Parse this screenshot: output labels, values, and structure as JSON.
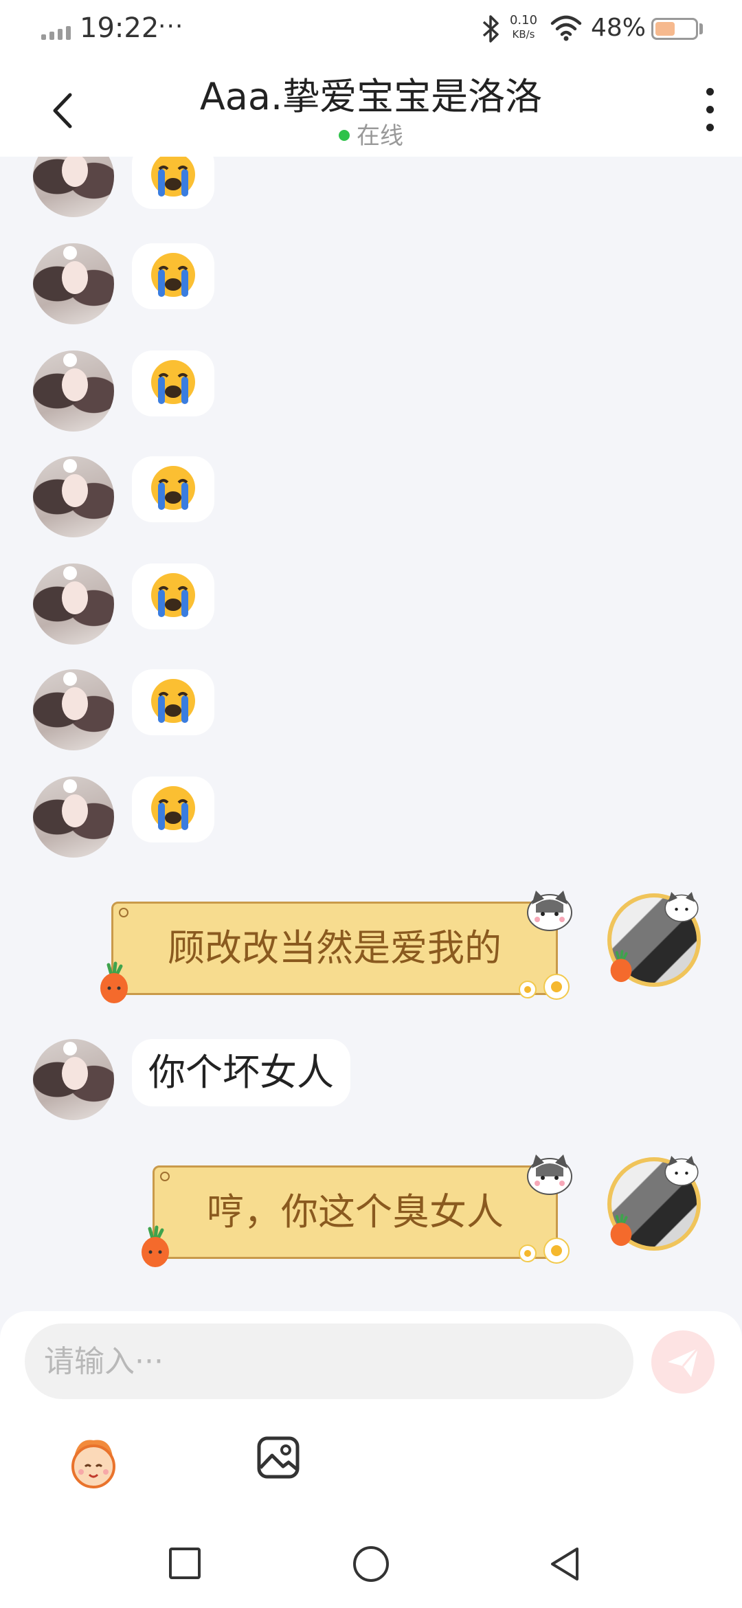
{
  "status_bar": {
    "time": "19:22",
    "more_indicator": "···",
    "net_speed_value": "0.10",
    "net_speed_unit": "KB/s",
    "battery_percent": "48%"
  },
  "header": {
    "title": "Aaa.挚爱宝宝是洛洛",
    "status": "在线",
    "status_color": "#2ec24a"
  },
  "messages": [
    {
      "side": "left",
      "type": "emoji",
      "emoji": "loudly-crying-face"
    },
    {
      "side": "left",
      "type": "emoji",
      "emoji": "loudly-crying-face"
    },
    {
      "side": "left",
      "type": "emoji",
      "emoji": "loudly-crying-face"
    },
    {
      "side": "left",
      "type": "emoji",
      "emoji": "loudly-crying-face"
    },
    {
      "side": "left",
      "type": "emoji",
      "emoji": "loudly-crying-face"
    },
    {
      "side": "left",
      "type": "emoji",
      "emoji": "loudly-crying-face"
    },
    {
      "side": "left",
      "type": "emoji",
      "emoji": "loudly-crying-face"
    },
    {
      "side": "right",
      "type": "text",
      "text": "顾改改当然是爱我的"
    },
    {
      "side": "left",
      "type": "text",
      "text": "你个坏女人"
    },
    {
      "side": "right",
      "type": "text",
      "text": "哼，你这个臭女人"
    }
  ],
  "composer": {
    "placeholder": "请输入···",
    "send_color": "#fde3e3"
  },
  "colors": {
    "sent_bubble": "#f7dc8f",
    "sent_border": "#c99a4a",
    "sent_text": "#8a5a1f",
    "chat_bg": "#f4f5f9"
  }
}
